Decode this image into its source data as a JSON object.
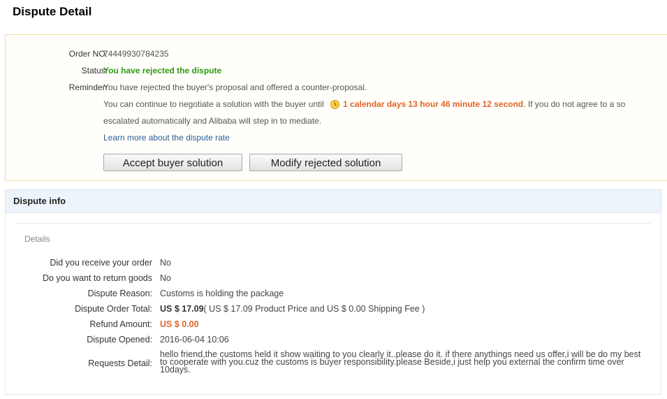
{
  "page": {
    "title": "Dispute Detail"
  },
  "status_panel": {
    "order_no_label": "Order NO:",
    "order_no": "74449930784235",
    "status_label": "Status:",
    "status": "You have rejected the dispute",
    "reminder_label": "Reminder:",
    "reminder_line1": "You have rejected the buyer's proposal and offered a counter-proposal.",
    "reminder_line2_prefix": "You can continue to negotiate a solution with the buyer until",
    "countdown": "1 calendar days 13 hour 46 minute 12 second",
    "reminder_line2_suffix": ". If you do not agree to a so",
    "reminder_line3": "escalated automatically and Alibaba will step in to mediate.",
    "learn_more_link": "Learn more about the dispute rate",
    "accept_button": "Accept buyer solution",
    "modify_button": "Modify rejected solution",
    "colors": {
      "status": "#2e9a14",
      "countdown": "#e0662a",
      "link": "#2a5d9a"
    }
  },
  "dispute_info": {
    "header": "Dispute info",
    "section_label": "Details",
    "fields": {
      "received_label": "Did you receive your order",
      "received": "No",
      "return_label": "Do you want to return goods",
      "return": "No",
      "reason_label": "Dispute Reason:",
      "reason": "Customs is holding the package",
      "total_label": "Dispute Order Total:",
      "total_amount": "US $ 17.09",
      "total_breakdown": "( US $ 17.09 Product Price and US $ 0.00 Shipping Fee )",
      "refund_label": "Refund Amount:",
      "refund_amount": "US $ 0.00",
      "opened_label": "Dispute Opened:",
      "opened": "2016-06-04 10:06",
      "requests_label": "Requests Detail:",
      "requests": "hello friend,the customs held it show waiting to you clearly it..please do it. if there anythings need us offer,i will be do my best to cooperate with you.cuz the customs is buyer responsibility.please Beside,i just help you external the confirm time over 10days."
    },
    "colors": {
      "refund": "#e0662a",
      "header_bg": "#eef4fb"
    }
  }
}
